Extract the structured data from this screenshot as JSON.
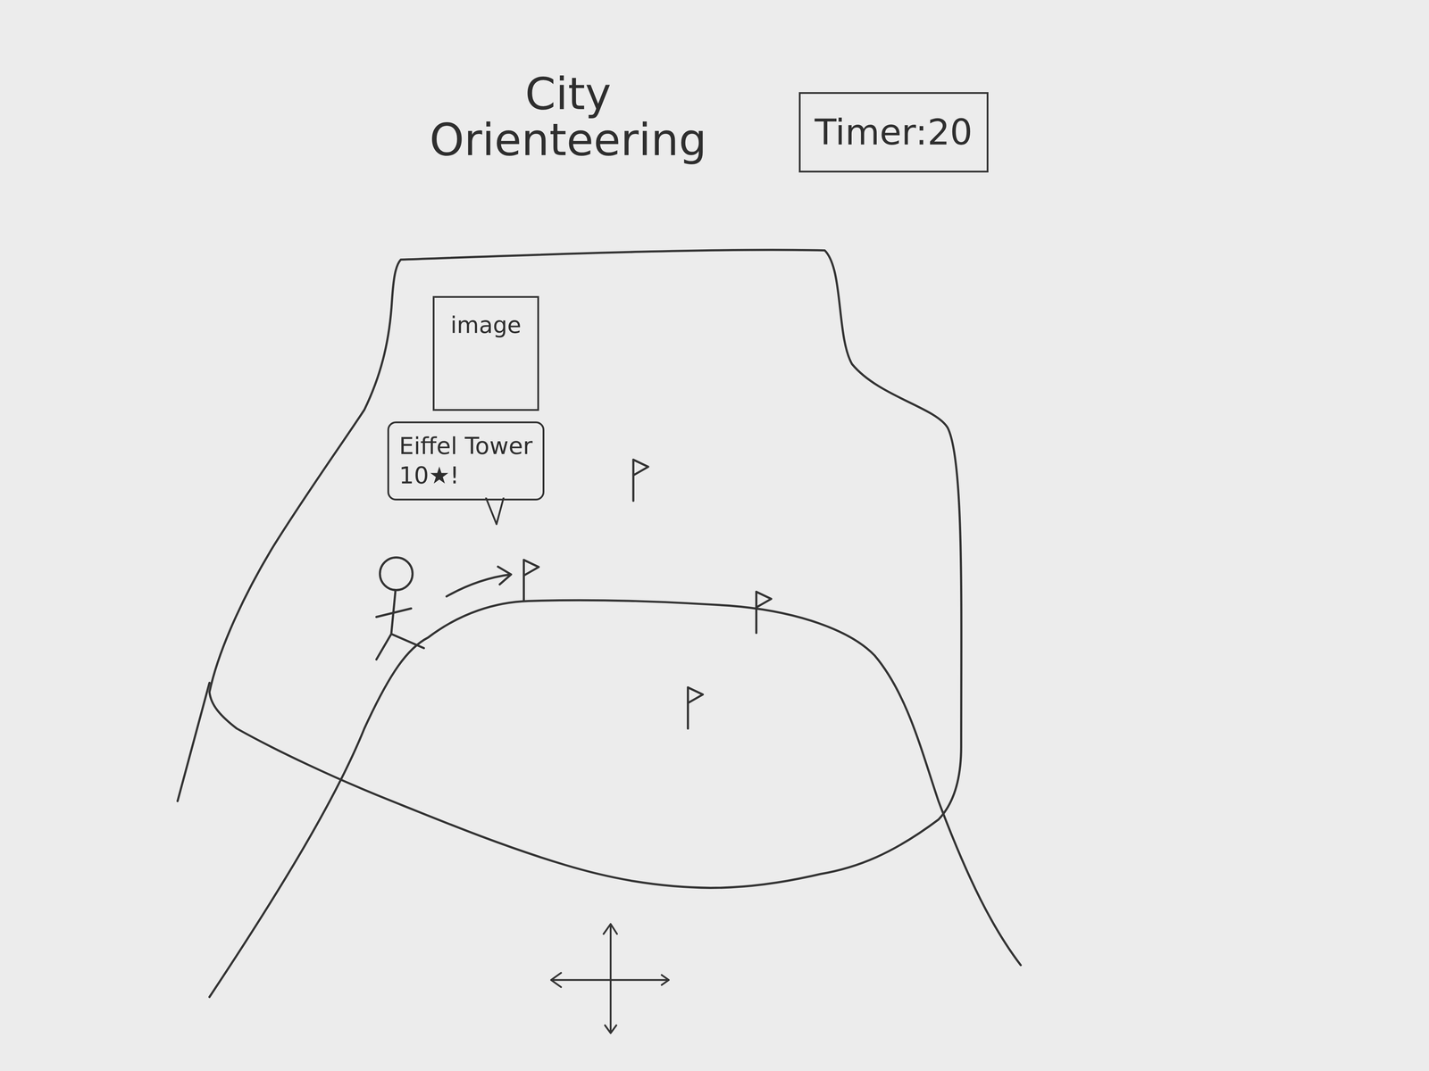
{
  "title": [
    "City",
    "Orienteering"
  ],
  "timer": {
    "label": "Timer:",
    "value": "20"
  },
  "flags": [
    {
      "selected": false
    },
    {
      "selected": true,
      "image": "image",
      "landmark": "Eiffel Tower",
      "reward": "10★!"
    },
    {
      "selected": false
    },
    {
      "selected": false
    }
  ]
}
